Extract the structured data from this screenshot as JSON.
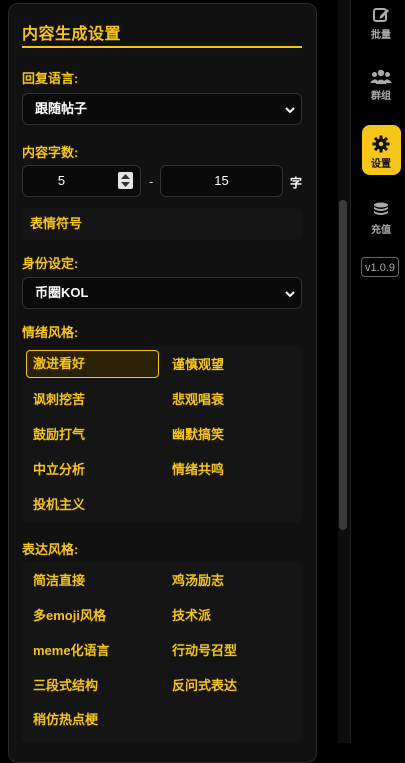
{
  "panel": {
    "title": "内容生成设置",
    "reply_language": {
      "label": "回复语言:",
      "selected": "跟随帖子"
    },
    "word_count": {
      "label": "内容字数:",
      "min": "5",
      "separator": "-",
      "max": "15",
      "unit": "字"
    },
    "emoji_option": "表情符号",
    "identity": {
      "label": "身份设定:",
      "selected": "币圈KOL"
    },
    "emotion_style": {
      "label": "情绪风格:",
      "options": [
        "激进看好",
        "谨慎观望",
        "讽刺挖苦",
        "悲观唱衰",
        "鼓励打气",
        "幽默搞笑",
        "中立分析",
        "情绪共鸣",
        "投机主义"
      ],
      "selected": "激进看好"
    },
    "expression_style": {
      "label": "表达风格:",
      "options": [
        "简洁直接",
        "鸡汤励志",
        "多emoji风格",
        "技术派",
        "meme化语言",
        "行动号召型",
        "三段式结构",
        "反问式表达",
        "稍仿热点梗"
      ]
    }
  },
  "sidebar": {
    "items": [
      {
        "label": "批量",
        "icon": "edit-icon"
      },
      {
        "label": "群组",
        "icon": "users-icon"
      },
      {
        "label": "设置",
        "icon": "gear-icon",
        "active": true
      },
      {
        "label": "充值",
        "icon": "coins-icon"
      }
    ],
    "version": "v1.0.9"
  },
  "colors": {
    "accent": "#f5c518",
    "background": "#000000",
    "panel": "#111111"
  }
}
